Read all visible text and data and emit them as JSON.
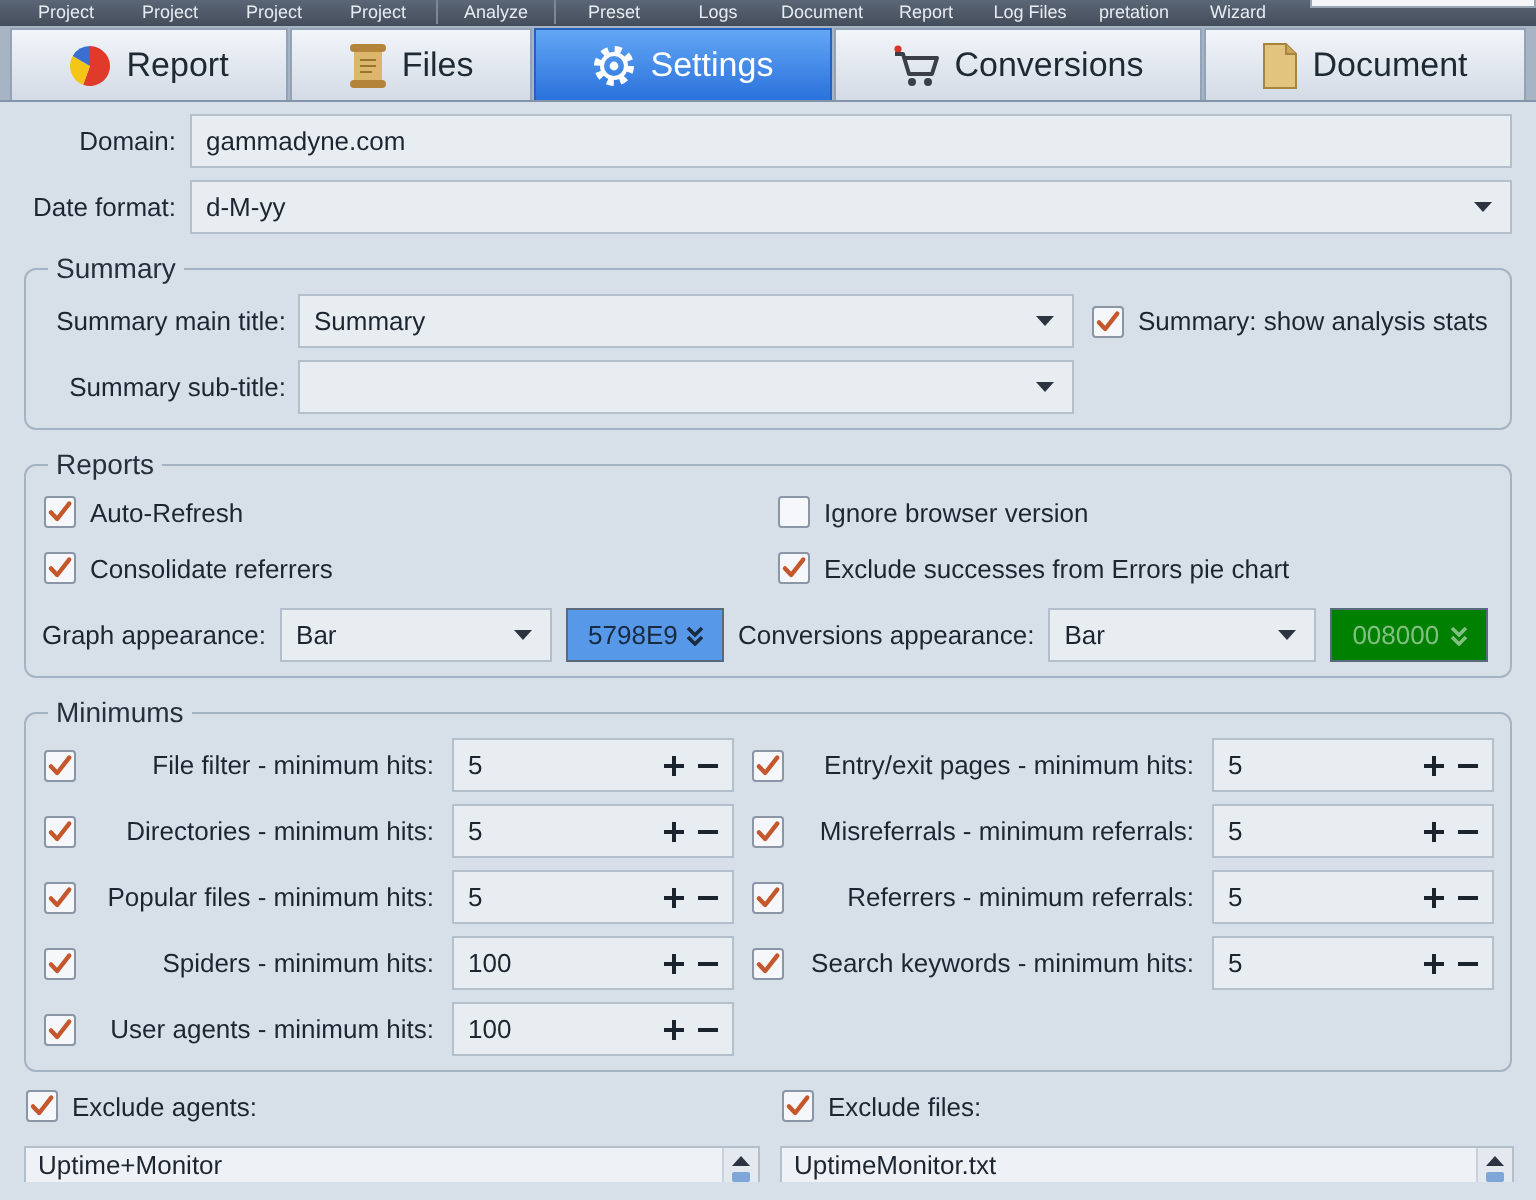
{
  "toolbar": {
    "items": [
      "Project",
      "Project",
      "Project",
      "Project",
      "Analyze",
      "Preset",
      "Logs",
      "Document",
      "Report",
      "Log Files",
      "pretation",
      "Wizard"
    ]
  },
  "tabs": [
    {
      "label": "Report",
      "selected": false
    },
    {
      "label": "Files",
      "selected": false
    },
    {
      "label": "Settings",
      "selected": true
    },
    {
      "label": "Conversions",
      "selected": false
    },
    {
      "label": "Document",
      "selected": false
    }
  ],
  "general": {
    "domain": {
      "label": "Domain:",
      "value": "gammadyne.com"
    },
    "date_format": {
      "label": "Date format:",
      "value": "d-M-yy"
    }
  },
  "summary": {
    "title": "Summary",
    "main_title": {
      "label": "Summary main title:",
      "value": "Summary"
    },
    "show_stats": {
      "label": "Summary: show analysis stats",
      "checked": true
    },
    "sub_title": {
      "label": "Summary sub-title:"
    }
  },
  "reports": {
    "title": "Reports",
    "options": [
      {
        "label": "Auto-Refresh",
        "checked": true
      },
      {
        "label": "Ignore browser version",
        "checked": false
      },
      {
        "label": "Consolidate referrers",
        "checked": true
      },
      {
        "label": "Exclude successes from Errors pie chart",
        "checked": true
      }
    ],
    "graph": {
      "label": "Graph appearance:",
      "value": "Bar",
      "color": "#5798e9",
      "code": "5798E9"
    },
    "conversions": {
      "label": "Conversions appearance:",
      "value": "Bar",
      "color": "#008000",
      "code": "008000"
    }
  },
  "minimums": {
    "title": "Minimums",
    "rows": [
      {
        "label": "File filter - minimum hits:",
        "value": "5",
        "checked": true
      },
      {
        "label": "Entry/exit pages - minimum hits:",
        "value": "5",
        "checked": true
      },
      {
        "label": "Directories - minimum hits:",
        "value": "5",
        "checked": true
      },
      {
        "label": "Misreferrals - minimum referrals:",
        "value": "5",
        "checked": true
      },
      {
        "label": "Popular files - minimum hits:",
        "value": "5",
        "checked": true
      },
      {
        "label": "Referrers - minimum referrals:",
        "value": "5",
        "checked": true
      },
      {
        "label": "Spiders - minimum hits:",
        "value": "100",
        "checked": true
      },
      {
        "label": "Search keywords - minimum hits:",
        "value": "5",
        "checked": true
      },
      {
        "label": "User agents - minimum hits:",
        "value": "100",
        "checked": true
      }
    ]
  },
  "exclusions": [
    {
      "label": "Exclude agents:",
      "checked": true,
      "lines": [
        "Uptime+Monitor"
      ]
    },
    {
      "label": "Exclude files:",
      "checked": true,
      "lines": [
        "UptimeMonitor.txt"
      ]
    }
  ]
}
